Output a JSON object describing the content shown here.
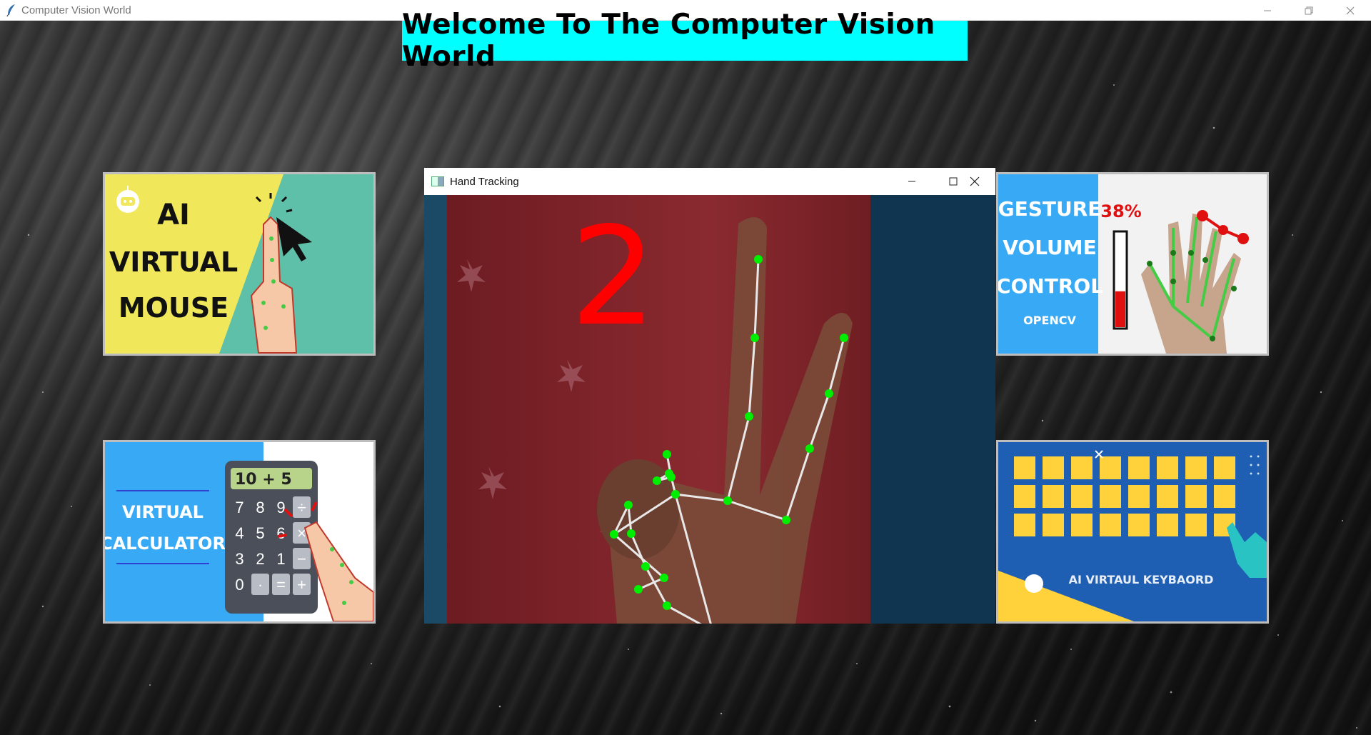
{
  "window": {
    "title": "Computer Vision World"
  },
  "banner": {
    "text": "Welcome To The Computer Vision World"
  },
  "cards": {
    "mouse": {
      "line1": "AI",
      "line2": "VIRTUAL",
      "line3": "MOUSE"
    },
    "calculator": {
      "line1": "VIRTUAL",
      "line2": "CALCULATOR",
      "display": "10 + 5",
      "keys": [
        "7",
        "8",
        "9",
        "÷",
        "4",
        "5",
        "6",
        "×",
        "3",
        "2",
        "1",
        "−",
        "0",
        "·",
        "=",
        "+"
      ]
    },
    "volume": {
      "line1": "GESTURE",
      "line2": "VOLUME",
      "line3": "CONTROL",
      "line4": "OPENCV",
      "percent": "38%"
    },
    "keyboard": {
      "label": "AI VIRTAUL KEYBAORD"
    }
  },
  "hand_tracking": {
    "title": "Hand Tracking",
    "finger_count": "2"
  },
  "colors": {
    "banner": "#00ffff",
    "finger_count": "#ff0000",
    "landmark": "#00ee00",
    "connection": "#e8e8e8"
  }
}
